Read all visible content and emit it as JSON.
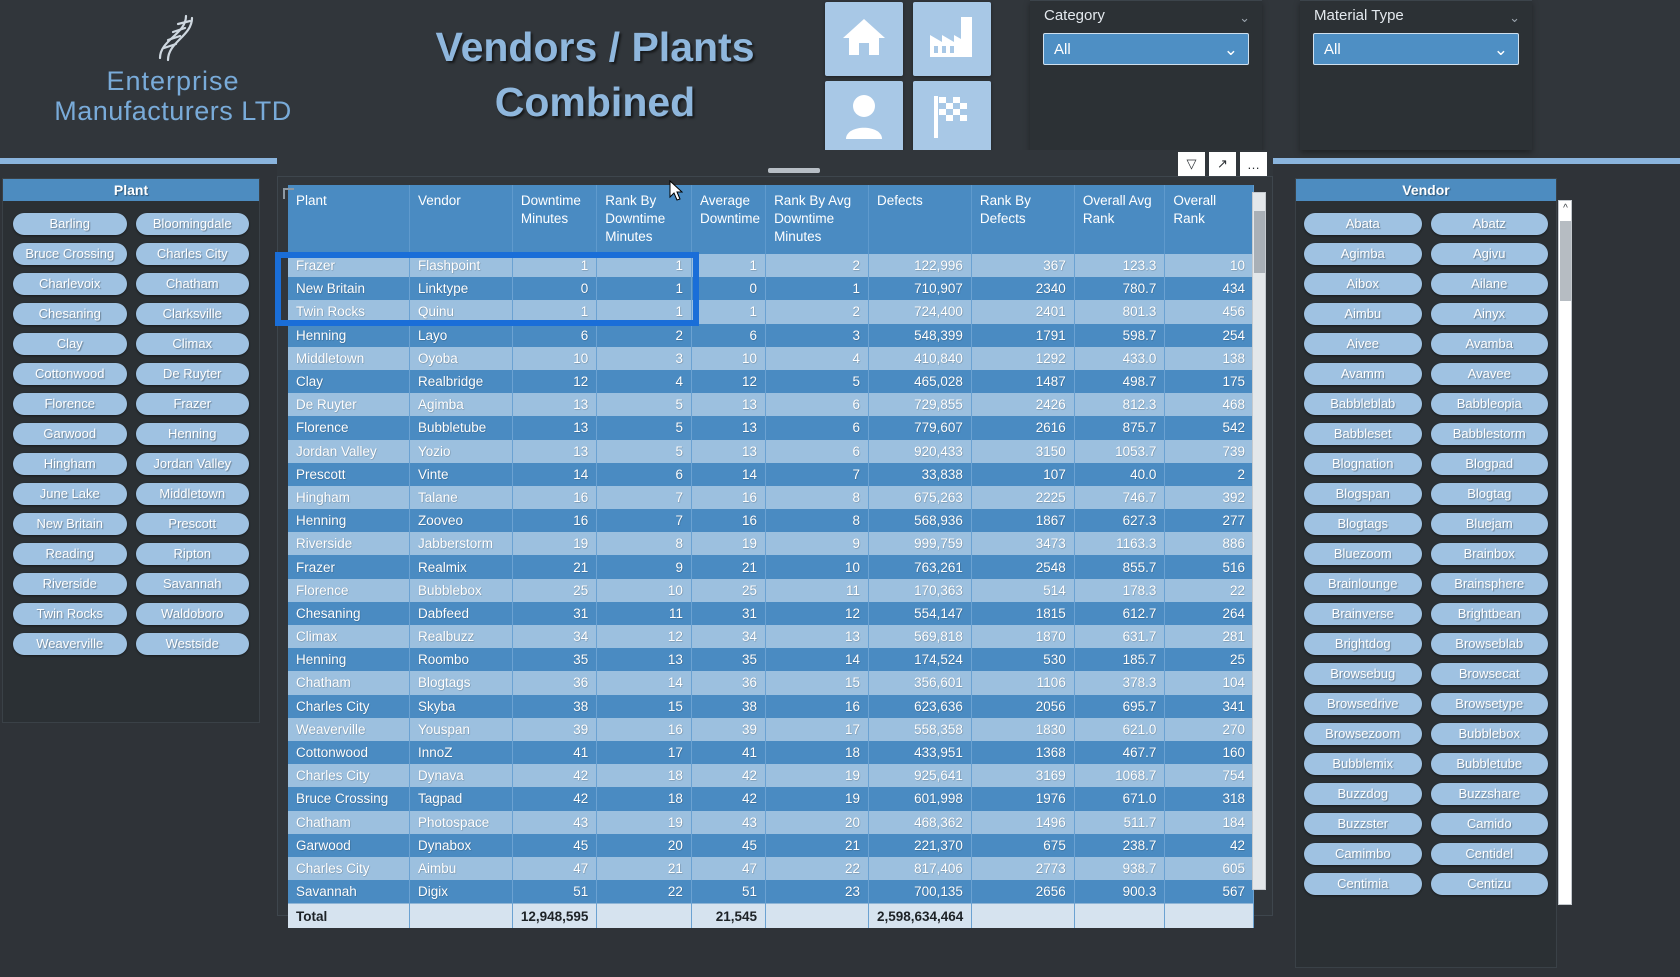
{
  "brand": {
    "line1": "Enterprise",
    "line2": "Manufacturers LTD",
    "logo_icon": "dna-helix-icon"
  },
  "header": {
    "title_line1": "Vendors / Plants",
    "title_line2": "Combined",
    "nav_buttons": [
      {
        "name": "home-icon",
        "label": "Home"
      },
      {
        "name": "factory-icon",
        "label": "Plants"
      },
      {
        "name": "person-icon",
        "label": "Vendors"
      },
      {
        "name": "checkered-flag-icon",
        "label": "Performance"
      }
    ],
    "slicers": [
      {
        "label": "Category",
        "value": "All",
        "caret": "⌄"
      },
      {
        "label": "Material Type",
        "value": "All",
        "caret": "⌄"
      }
    ]
  },
  "visual_toolbar": {
    "icons": [
      {
        "name": "filter-icon",
        "glyph": "▽"
      },
      {
        "name": "focus-mode-icon",
        "glyph": "↗"
      },
      {
        "name": "more-options-icon",
        "glyph": "…"
      }
    ]
  },
  "plant_slicer": {
    "title": "Plant",
    "items": [
      "Barling",
      "Bloomingdale",
      "Bruce Crossing",
      "Charles City",
      "Charlevoix",
      "Chatham",
      "Chesaning",
      "Clarksville",
      "Clay",
      "Climax",
      "Cottonwood",
      "De Ruyter",
      "Florence",
      "Frazer",
      "Garwood",
      "Henning",
      "Hingham",
      "Jordan Valley",
      "June Lake",
      "Middletown",
      "New Britain",
      "Prescott",
      "Reading",
      "Ripton",
      "Riverside",
      "Savannah",
      "Twin Rocks",
      "Waldoboro",
      "Weaverville",
      "Westside"
    ]
  },
  "vendor_slicer": {
    "title": "Vendor",
    "items": [
      "Abata",
      "Abatz",
      "Agimba",
      "Agivu",
      "Aibox",
      "Ailane",
      "Aimbu",
      "Ainyx",
      "Aivee",
      "Avamba",
      "Avamm",
      "Avavee",
      "Babbleblab",
      "Babbleopia",
      "Babbleset",
      "Babblestorm",
      "Blognation",
      "Blogpad",
      "Blogspan",
      "Blogtag",
      "Blogtags",
      "Bluejam",
      "Bluezoom",
      "Brainbox",
      "Brainlounge",
      "Brainsphere",
      "Brainverse",
      "Brightbean",
      "Brightdog",
      "Browseblab",
      "Browsebug",
      "Browsecat",
      "Browsedrive",
      "Browsetype",
      "Browsezoom",
      "Bubblebox",
      "Bubblemix",
      "Bubbletube",
      "Buzzdog",
      "Buzzshare",
      "Buzzster",
      "Camido",
      "Camimbo",
      "Centidel",
      "Centimia",
      "Centizu"
    ]
  },
  "table": {
    "columns": [
      "Plant",
      "Vendor",
      "Downtime Minutes",
      "Rank By Downtime Minutes",
      "Average Downtime",
      "Rank By Avg Downtime Minutes",
      "Defects",
      "Rank By Defects",
      "Overall Avg Rank",
      "Overall Rank"
    ],
    "rows": [
      [
        "Frazer",
        "Flashpoint",
        "1",
        "1",
        "1",
        "2",
        "122,996",
        "367",
        "123.3",
        "10"
      ],
      [
        "New Britain",
        "Linktype",
        "0",
        "1",
        "0",
        "1",
        "710,907",
        "2340",
        "780.7",
        "434"
      ],
      [
        "Twin Rocks",
        "Quinu",
        "1",
        "1",
        "1",
        "2",
        "724,400",
        "2401",
        "801.3",
        "456"
      ],
      [
        "Henning",
        "Layo",
        "6",
        "2",
        "6",
        "3",
        "548,399",
        "1791",
        "598.7",
        "254"
      ],
      [
        "Middletown",
        "Oyoba",
        "10",
        "3",
        "10",
        "4",
        "410,840",
        "1292",
        "433.0",
        "138"
      ],
      [
        "Clay",
        "Realbridge",
        "12",
        "4",
        "12",
        "5",
        "465,028",
        "1487",
        "498.7",
        "175"
      ],
      [
        "De Ruyter",
        "Agimba",
        "13",
        "5",
        "13",
        "6",
        "729,855",
        "2426",
        "812.3",
        "468"
      ],
      [
        "Florence",
        "Bubbletube",
        "13",
        "5",
        "13",
        "6",
        "779,607",
        "2616",
        "875.7",
        "542"
      ],
      [
        "Jordan Valley",
        "Yozio",
        "13",
        "5",
        "13",
        "6",
        "920,433",
        "3150",
        "1053.7",
        "739"
      ],
      [
        "Prescott",
        "Vinte",
        "14",
        "6",
        "14",
        "7",
        "33,838",
        "107",
        "40.0",
        "2"
      ],
      [
        "Hingham",
        "Talane",
        "16",
        "7",
        "16",
        "8",
        "675,263",
        "2225",
        "746.7",
        "392"
      ],
      [
        "Henning",
        "Zooveo",
        "16",
        "7",
        "16",
        "8",
        "568,936",
        "1867",
        "627.3",
        "277"
      ],
      [
        "Riverside",
        "Jabberstorm",
        "19",
        "8",
        "19",
        "9",
        "999,759",
        "3473",
        "1163.3",
        "886"
      ],
      [
        "Frazer",
        "Realmix",
        "21",
        "9",
        "21",
        "10",
        "763,261",
        "2548",
        "855.7",
        "516"
      ],
      [
        "Florence",
        "Bubblebox",
        "25",
        "10",
        "25",
        "11",
        "170,363",
        "514",
        "178.3",
        "22"
      ],
      [
        "Chesaning",
        "Dabfeed",
        "31",
        "11",
        "31",
        "12",
        "554,147",
        "1815",
        "612.7",
        "264"
      ],
      [
        "Climax",
        "Realbuzz",
        "34",
        "12",
        "34",
        "13",
        "569,818",
        "1870",
        "631.7",
        "281"
      ],
      [
        "Henning",
        "Roombo",
        "35",
        "13",
        "35",
        "14",
        "174,524",
        "530",
        "185.7",
        "25"
      ],
      [
        "Chatham",
        "Blogtags",
        "36",
        "14",
        "36",
        "15",
        "356,601",
        "1106",
        "378.3",
        "104"
      ],
      [
        "Charles City",
        "Skyba",
        "38",
        "15",
        "38",
        "16",
        "623,636",
        "2056",
        "695.7",
        "341"
      ],
      [
        "Weaverville",
        "Youspan",
        "39",
        "16",
        "39",
        "17",
        "558,358",
        "1830",
        "621.0",
        "270"
      ],
      [
        "Cottonwood",
        "InnoZ",
        "41",
        "17",
        "41",
        "18",
        "433,951",
        "1368",
        "467.7",
        "160"
      ],
      [
        "Charles City",
        "Dynava",
        "42",
        "18",
        "42",
        "19",
        "925,641",
        "3169",
        "1068.7",
        "754"
      ],
      [
        "Bruce Crossing",
        "Tagpad",
        "42",
        "18",
        "42",
        "19",
        "601,998",
        "1976",
        "671.0",
        "318"
      ],
      [
        "Chatham",
        "Photospace",
        "43",
        "19",
        "43",
        "20",
        "468,362",
        "1496",
        "511.7",
        "184"
      ],
      [
        "Garwood",
        "Dynabox",
        "45",
        "20",
        "45",
        "21",
        "221,370",
        "675",
        "238.7",
        "42"
      ],
      [
        "Charles City",
        "Aimbu",
        "47",
        "21",
        "47",
        "22",
        "817,406",
        "2773",
        "938.7",
        "605"
      ],
      [
        "Savannah",
        "Digix",
        "51",
        "22",
        "51",
        "23",
        "700,135",
        "2656",
        "900.3",
        "567"
      ]
    ],
    "total_row": {
      "label": "Total",
      "downtime_minutes": "12,948,595",
      "average_downtime": "21,545",
      "defects": "2,598,634,464"
    },
    "selection": {
      "rows": [
        "Frazer / Flashpoint",
        "New Britain / Linktype",
        "Twin Rocks / Quinu"
      ],
      "color": "#1a6ed8"
    }
  },
  "colors": {
    "accent": "#4a8bc2",
    "row_light": "#9cc0df",
    "row_dark": "#4a8bc2",
    "chip": "#9fc2e2",
    "background": "#2f3338",
    "brand_blue": "#79abd9"
  }
}
